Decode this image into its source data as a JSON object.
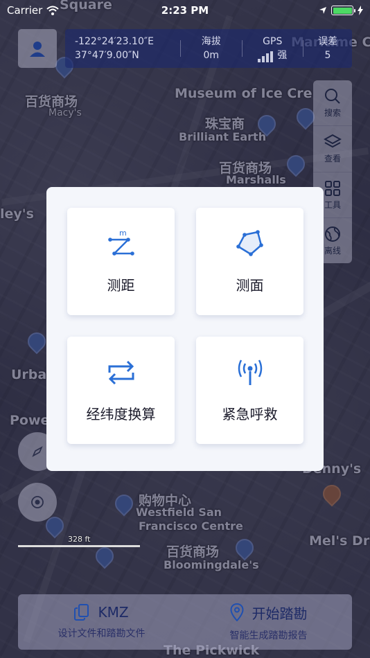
{
  "status_bar": {
    "carrier": "Carrier",
    "time": "2:23 PM"
  },
  "info_bar": {
    "longitude": "-122°24′23.10″E",
    "latitude": "37°47′9.00″N",
    "altitude_label": "海拔",
    "altitude_value": "0m",
    "gps_label": "GPS",
    "gps_value": "强",
    "error_label": "误差",
    "error_value": "5"
  },
  "right_toolbar": [
    {
      "label": "搜索",
      "icon": "search-icon"
    },
    {
      "label": "查看",
      "icon": "layers-icon"
    },
    {
      "label": "工具",
      "icon": "grid-icon"
    },
    {
      "label": "离线",
      "icon": "globe-icon"
    }
  ],
  "modal": {
    "cards": [
      {
        "label": "测距",
        "icon": "distance-measure-icon"
      },
      {
        "label": "测面",
        "icon": "area-measure-icon"
      },
      {
        "label": "经纬度换算",
        "icon": "convert-arrows-icon"
      },
      {
        "label": "紧急呼救",
        "icon": "signal-tower-icon"
      }
    ],
    "distance_unit_mark": "m"
  },
  "scale_bar": {
    "label": "328 ft"
  },
  "bottom_bar": {
    "kmz_title": "KMZ",
    "kmz_sub": "设计文件和踏勘文件",
    "survey_title": "开始踏勘",
    "survey_sub": "智能生成踏勘报告"
  },
  "map_labels": {
    "l1": "百货商场",
    "l2": "Macy's",
    "l3": "Museum of Ice Cre",
    "l4": "珠宝商",
    "l5": "Brilliant Earth",
    "l6": "百货商场",
    "l7": "Marshalls",
    "l8": "Urba",
    "l9": "Powe",
    "l10": "购物中心",
    "l11": "Westfield San",
    "l12": "Francisco Centre",
    "l13": "百货商场",
    "l14": "Bloomingdale's",
    "l15": "Mel's Dri",
    "l16": "Denny's",
    "l17": "The Pickwick",
    "l18": "Square",
    "l19": "ley's",
    "l20": "Maritime C"
  },
  "colors": {
    "accent": "#2a6fd6",
    "info_bar_bg": "#1c286e",
    "modal_bg": "#f4f6fb"
  }
}
